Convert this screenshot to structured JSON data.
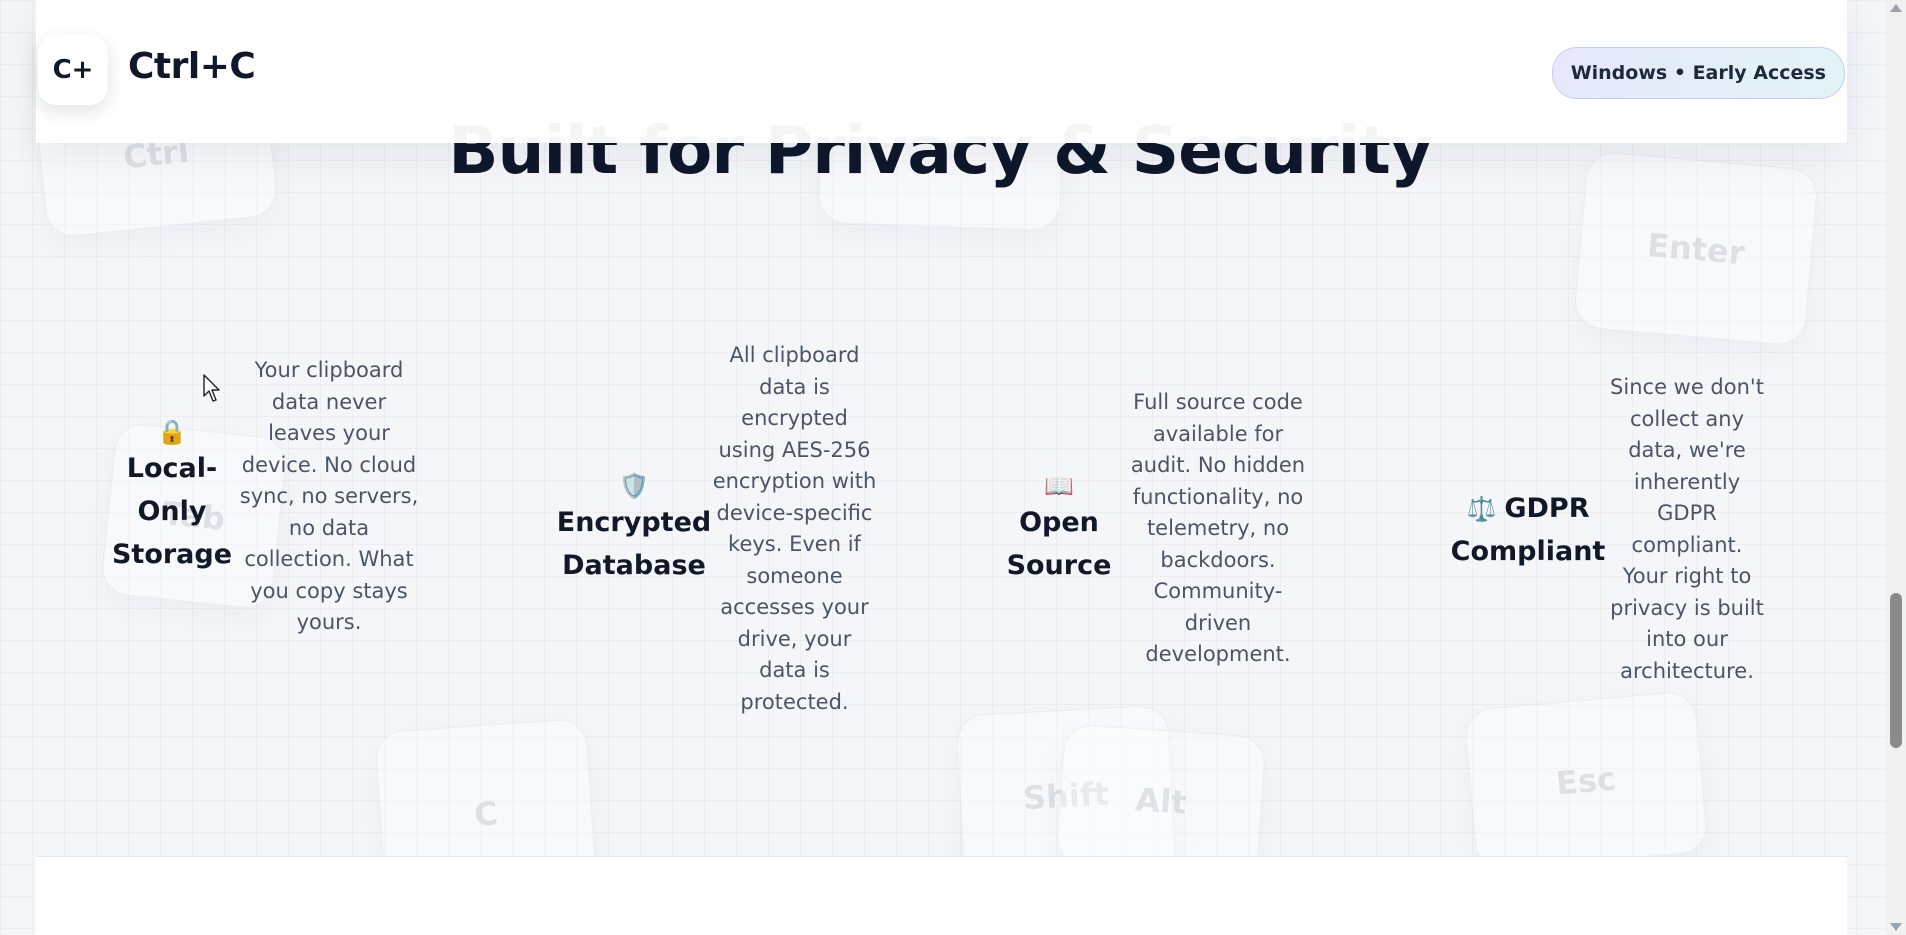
{
  "header": {
    "logo_text": "C+",
    "brand_name": "Ctrl+C",
    "badge_text": "Windows • Early Access"
  },
  "section": {
    "title": "Built for Privacy & Security"
  },
  "features": [
    {
      "icon": "lock-icon",
      "icon_glyph": "🔒",
      "title": "Local-Only Storage",
      "title_lines": [
        "Local-",
        "Only",
        "Storage"
      ],
      "text": "Your clipboard data never leaves your device. No cloud sync, no servers, no data collection. What you copy stays yours."
    },
    {
      "icon": "shield-icon",
      "icon_glyph": "🛡️",
      "title": "Encrypted Database",
      "title_lines": [
        "Encrypted",
        "Database"
      ],
      "text": "All clipboard data is encrypted using AES-256 encryption with device-specific keys. Even if someone accesses your drive, your data is protected."
    },
    {
      "icon": "book-icon",
      "icon_glyph": "📖",
      "title": "Open Source",
      "title_lines": [
        "Open",
        "Source"
      ],
      "text": "Full source code available for audit. No hidden functionality, no telemetry, no backdoors. Community-driven development."
    },
    {
      "icon": "scales-icon",
      "icon_glyph": "⚖️",
      "title": "GDPR Compliant",
      "title_lines": [
        "GDPR",
        "Compliant"
      ],
      "text": "Since we don't collect any data, we're inherently GDPR compliant. Your right to privacy is built into our architecture."
    }
  ],
  "background_keys": [
    "Ctrl",
    "Enter",
    "Tab",
    "C",
    "Shift",
    "Alt",
    "Esc"
  ],
  "colors": {
    "background": "#f4f6fa",
    "heading": "#0f172a",
    "body_text": "#4b5563",
    "badge_gradient_start": "#e6e8fb",
    "badge_gradient_end": "#e2f3f5",
    "badge_border": "#c7cdf3"
  }
}
